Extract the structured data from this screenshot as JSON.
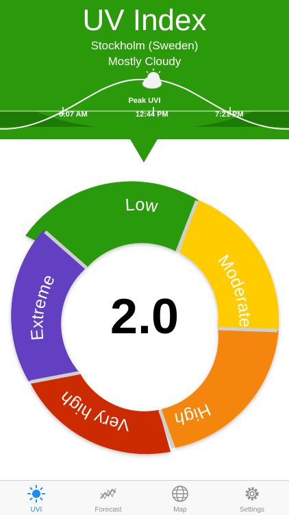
{
  "app": {
    "title": "UV Index",
    "location": "Stockholm (Sweden)",
    "condition": "Mostly Cloudy"
  },
  "sun_path": {
    "peak_label": "Peak UVI",
    "sunrise": "6:07 AM",
    "peak_time": "12:44 PM",
    "sunset": "7:21 PM",
    "weather_icon": "partly-cloudy-icon"
  },
  "gauge": {
    "value": "2.0",
    "segments": [
      {
        "label": "Low",
        "color": "#2a9a0a"
      },
      {
        "label": "Moderate",
        "color": "#ffcc00"
      },
      {
        "label": "High",
        "color": "#f5860a"
      },
      {
        "label": "Very high",
        "color": "#cc2b06"
      },
      {
        "label": "Extreme",
        "color": "#6440c2"
      }
    ]
  },
  "tabs": [
    {
      "label": "UVI",
      "icon": "sun-icon",
      "active": true
    },
    {
      "label": "Forecast",
      "icon": "chart-icon",
      "active": false
    },
    {
      "label": "Map",
      "icon": "globe-icon",
      "active": false
    },
    {
      "label": "Settings",
      "icon": "gear-icon",
      "active": false
    }
  ],
  "colors": {
    "header_bg": "#2a9a0a",
    "active_tab": "#1a8cff",
    "inactive_tab": "#8e8e93"
  }
}
